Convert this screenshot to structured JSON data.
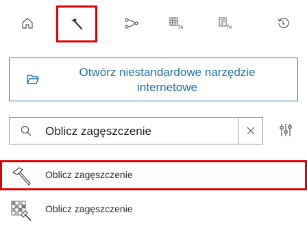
{
  "tabs": [
    {
      "icon": "home-icon",
      "active": false
    },
    {
      "icon": "hammer-icon",
      "active": true
    },
    {
      "icon": "model-builder-icon",
      "active": false
    },
    {
      "icon": "raster-function-icon",
      "active": false
    },
    {
      "icon": "table-function-icon",
      "active": false
    },
    {
      "icon": "history-icon",
      "active": false
    }
  ],
  "open_tool": {
    "label": "Otwórz niestandardowe narzędzie internetowe",
    "icon": "folder-open-icon"
  },
  "search": {
    "value": "Oblicz zagęszczenie",
    "icon": "search-icon",
    "clear_icon": "close-icon",
    "filter_icon": "filter-sliders-icon"
  },
  "results": [
    {
      "label": "Oblicz zagęszczenie",
      "icon": "hammer-icon",
      "highlighted": true
    },
    {
      "label": "Oblicz zagęszczenie",
      "icon": "raster-tool-icon",
      "highlighted": false
    }
  ],
  "colors": {
    "accent": "#1f6fb3",
    "highlight": "#e00000"
  }
}
